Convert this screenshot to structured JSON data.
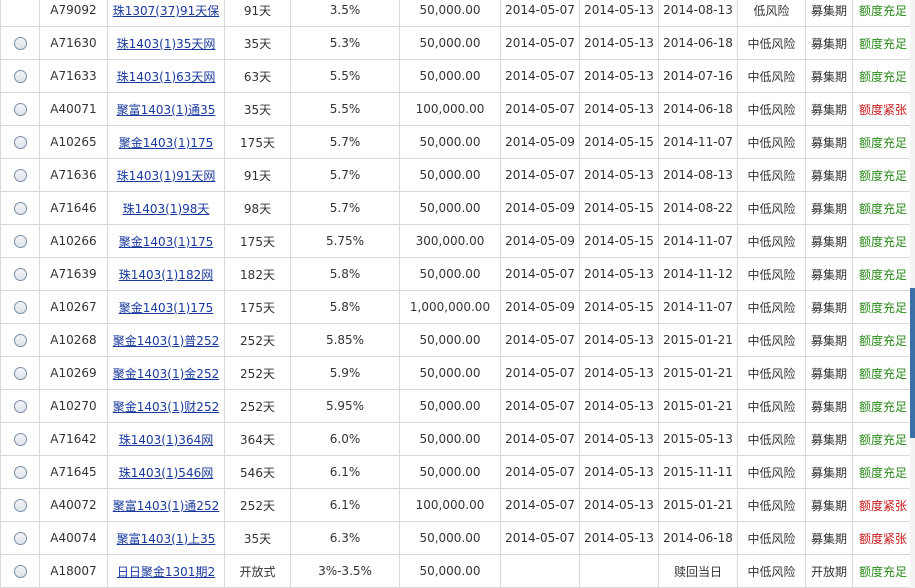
{
  "colors": {
    "link": "#1a3a9e",
    "quota_ok": "#2a8a1a",
    "quota_tight": "#c81818",
    "border": "#d9d9d9"
  },
  "icons": {
    "radio": "radio-button",
    "tight": "fire-icon"
  },
  "rows": [
    {
      "code": "A79092",
      "name": "珠1307(37)91天保",
      "term": "91天",
      "rate": "3.5%",
      "amount": "50,000.00",
      "d1": "2014-05-07",
      "d2": "2014-05-13",
      "d3": "2014-08-13",
      "risk": "低风险",
      "status": "募集期",
      "quota": "额度充足",
      "tight": false,
      "radio": false
    },
    {
      "code": "A71630",
      "name": "珠1403(1)35天网",
      "term": "35天",
      "rate": "5.3%",
      "amount": "50,000.00",
      "d1": "2014-05-07",
      "d2": "2014-05-13",
      "d3": "2014-06-18",
      "risk": "中低风险",
      "status": "募集期",
      "quota": "额度充足",
      "tight": false,
      "radio": true
    },
    {
      "code": "A71633",
      "name": "珠1403(1)63天网",
      "term": "63天",
      "rate": "5.5%",
      "amount": "50,000.00",
      "d1": "2014-05-07",
      "d2": "2014-05-13",
      "d3": "2014-07-16",
      "risk": "中低风险",
      "status": "募集期",
      "quota": "额度充足",
      "tight": false,
      "radio": true
    },
    {
      "code": "A40071",
      "name": "聚富1403(1)通35",
      "term": "35天",
      "rate": "5.5%",
      "amount": "100,000.00",
      "d1": "2014-05-07",
      "d2": "2014-05-13",
      "d3": "2014-06-18",
      "risk": "中低风险",
      "status": "募集期",
      "quota": "额度紧张",
      "tight": true,
      "radio": true
    },
    {
      "code": "A10265",
      "name": "聚金1403(1)175",
      "term": "175天",
      "rate": "5.7%",
      "amount": "50,000.00",
      "d1": "2014-05-09",
      "d2": "2014-05-15",
      "d3": "2014-11-07",
      "risk": "中低风险",
      "status": "募集期",
      "quota": "额度充足",
      "tight": false,
      "radio": true
    },
    {
      "code": "A71636",
      "name": "珠1403(1)91天网",
      "term": "91天",
      "rate": "5.7%",
      "amount": "50,000.00",
      "d1": "2014-05-07",
      "d2": "2014-05-13",
      "d3": "2014-08-13",
      "risk": "中低风险",
      "status": "募集期",
      "quota": "额度充足",
      "tight": false,
      "radio": true
    },
    {
      "code": "A71646",
      "name": "珠1403(1)98天",
      "term": "98天",
      "rate": "5.7%",
      "amount": "50,000.00",
      "d1": "2014-05-09",
      "d2": "2014-05-15",
      "d3": "2014-08-22",
      "risk": "中低风险",
      "status": "募集期",
      "quota": "额度充足",
      "tight": false,
      "radio": true
    },
    {
      "code": "A10266",
      "name": "聚金1403(1)175",
      "term": "175天",
      "rate": "5.75%",
      "amount": "300,000.00",
      "d1": "2014-05-09",
      "d2": "2014-05-15",
      "d3": "2014-11-07",
      "risk": "中低风险",
      "status": "募集期",
      "quota": "额度充足",
      "tight": false,
      "radio": true
    },
    {
      "code": "A71639",
      "name": "珠1403(1)182网",
      "term": "182天",
      "rate": "5.8%",
      "amount": "50,000.00",
      "d1": "2014-05-07",
      "d2": "2014-05-13",
      "d3": "2014-11-12",
      "risk": "中低风险",
      "status": "募集期",
      "quota": "额度充足",
      "tight": false,
      "radio": true
    },
    {
      "code": "A10267",
      "name": "聚金1403(1)175",
      "term": "175天",
      "rate": "5.8%",
      "amount": "1,000,000.00",
      "d1": "2014-05-09",
      "d2": "2014-05-15",
      "d3": "2014-11-07",
      "risk": "中低风险",
      "status": "募集期",
      "quota": "额度充足",
      "tight": false,
      "radio": true
    },
    {
      "code": "A10268",
      "name": "聚金1403(1)普252",
      "term": "252天",
      "rate": "5.85%",
      "amount": "50,000.00",
      "d1": "2014-05-07",
      "d2": "2014-05-13",
      "d3": "2015-01-21",
      "risk": "中低风险",
      "status": "募集期",
      "quota": "额度充足",
      "tight": false,
      "radio": true
    },
    {
      "code": "A10269",
      "name": "聚金1403(1)金252",
      "term": "252天",
      "rate": "5.9%",
      "amount": "50,000.00",
      "d1": "2014-05-07",
      "d2": "2014-05-13",
      "d3": "2015-01-21",
      "risk": "中低风险",
      "status": "募集期",
      "quota": "额度充足",
      "tight": false,
      "radio": true
    },
    {
      "code": "A10270",
      "name": "聚金1403(1)财252",
      "term": "252天",
      "rate": "5.95%",
      "amount": "50,000.00",
      "d1": "2014-05-07",
      "d2": "2014-05-13",
      "d3": "2015-01-21",
      "risk": "中低风险",
      "status": "募集期",
      "quota": "额度充足",
      "tight": false,
      "radio": true
    },
    {
      "code": "A71642",
      "name": "珠1403(1)364网",
      "term": "364天",
      "rate": "6.0%",
      "amount": "50,000.00",
      "d1": "2014-05-07",
      "d2": "2014-05-13",
      "d3": "2015-05-13",
      "risk": "中低风险",
      "status": "募集期",
      "quota": "额度充足",
      "tight": false,
      "radio": true
    },
    {
      "code": "A71645",
      "name": "珠1403(1)546网",
      "term": "546天",
      "rate": "6.1%",
      "amount": "50,000.00",
      "d1": "2014-05-07",
      "d2": "2014-05-13",
      "d3": "2015-11-11",
      "risk": "中低风险",
      "status": "募集期",
      "quota": "额度充足",
      "tight": false,
      "radio": true
    },
    {
      "code": "A40072",
      "name": "聚富1403(1)通252",
      "term": "252天",
      "rate": "6.1%",
      "amount": "100,000.00",
      "d1": "2014-05-07",
      "d2": "2014-05-13",
      "d3": "2015-01-21",
      "risk": "中低风险",
      "status": "募集期",
      "quota": "额度紧张",
      "tight": true,
      "radio": true
    },
    {
      "code": "A40074",
      "name": "聚富1403(1)上35",
      "term": "35天",
      "rate": "6.3%",
      "amount": "50,000.00",
      "d1": "2014-05-07",
      "d2": "2014-05-13",
      "d3": "2014-06-18",
      "risk": "中低风险",
      "status": "募集期",
      "quota": "额度紧张",
      "tight": true,
      "radio": true
    },
    {
      "code": "A18007",
      "name": "日日聚金1301期2",
      "term": "开放式",
      "rate": "3%-3.5%",
      "amount": "50,000.00",
      "d1": "",
      "d2": "",
      "d3": "赎回当日",
      "risk": "中低风险",
      "status": "开放期",
      "quota": "额度充足",
      "tight": false,
      "radio": true
    }
  ]
}
